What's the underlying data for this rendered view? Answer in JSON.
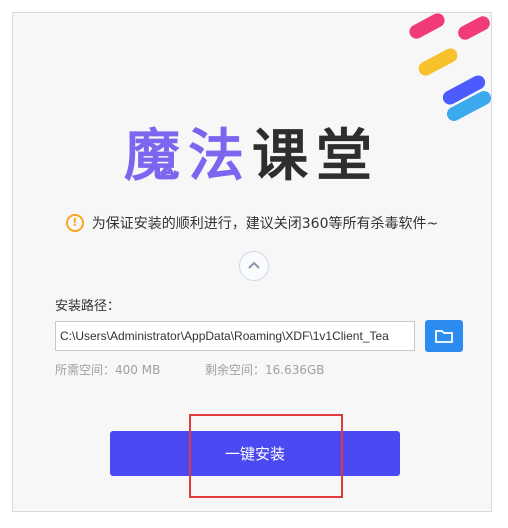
{
  "title": {
    "part1": "魔法",
    "part2": "课堂"
  },
  "notice": {
    "text": "为保证安装的顺利进行，建议关闭360等所有杀毒软件~"
  },
  "path": {
    "label": "安装路径：",
    "value": "C:\\Users\\Administrator\\AppData\\Roaming\\XDF\\1v1Client_Tea"
  },
  "space": {
    "required": "所需空间：400 MB",
    "remaining": "剩余空间：16.636GB"
  },
  "install_button": {
    "label": "一键安装"
  },
  "icons": {
    "warning": "warning-icon",
    "chevron": "chevron-up-icon",
    "folder": "folder-icon"
  },
  "colors": {
    "accent": "#4b49f2",
    "folder_button": "#2d8cf0",
    "highlight_box": "#e23b3b",
    "title_purple": "#7b66f0"
  }
}
